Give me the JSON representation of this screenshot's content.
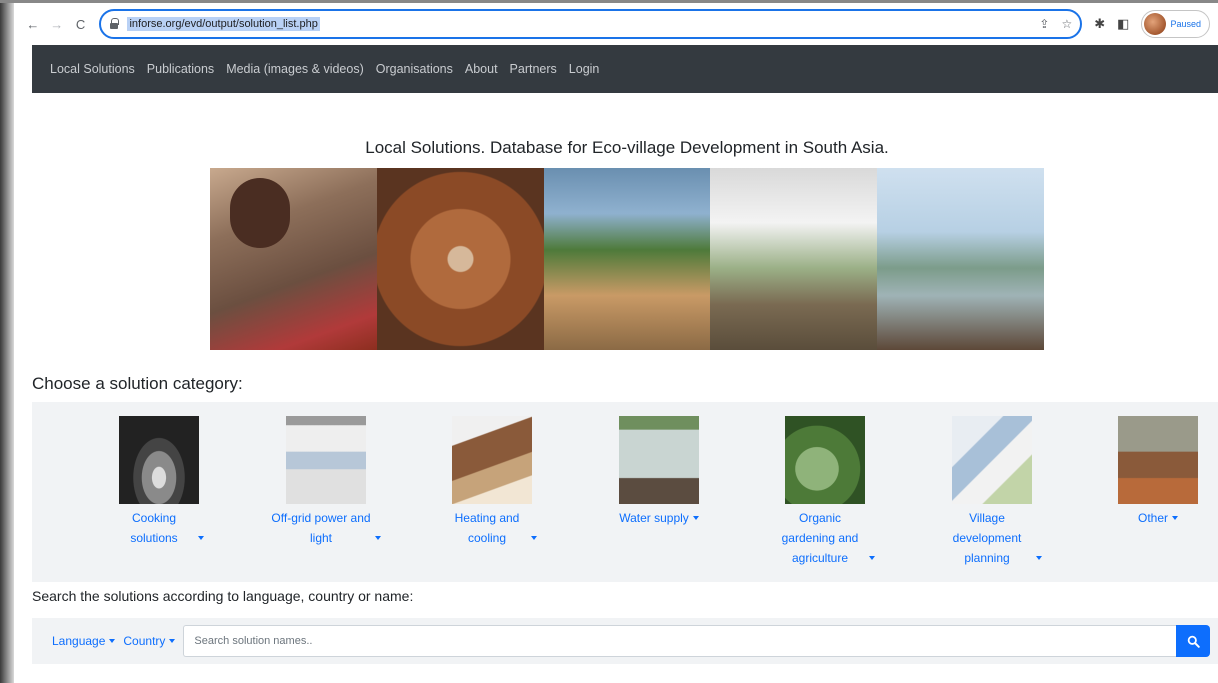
{
  "browser": {
    "url": "inforse.org/evd/output/solution_list.php",
    "profile_label": "Paused",
    "back_icon": "arrow-left-icon",
    "forward_icon": "arrow-right-icon",
    "reload_icon": "reload-icon"
  },
  "nav": {
    "items": [
      {
        "label": "Local Solutions"
      },
      {
        "label": "Publications"
      },
      {
        "label": "Media (images & videos)"
      },
      {
        "label": "Organisations"
      },
      {
        "label": "About"
      },
      {
        "label": "Partners"
      },
      {
        "label": "Login"
      }
    ]
  },
  "page": {
    "title": "Local Solutions. Database for Eco-village Development in South Asia.",
    "category_heading": "Choose a solution category:",
    "search_heading": "Search the solutions according to language, country or name:"
  },
  "categories": [
    {
      "label": "Cooking solutions"
    },
    {
      "label": "Off-grid power and light"
    },
    {
      "label": "Heating and cooling"
    },
    {
      "label": "Water supply"
    },
    {
      "label": "Organic gardening and agriculture"
    },
    {
      "label": "Village development planning"
    },
    {
      "label": "Other"
    }
  ],
  "search": {
    "language_label": "Language",
    "country_label": "Country",
    "placeholder": "Search solution names.."
  },
  "colors": {
    "navbar": "#343a40",
    "link": "#0d6efd",
    "panel": "#f1f3f5"
  }
}
